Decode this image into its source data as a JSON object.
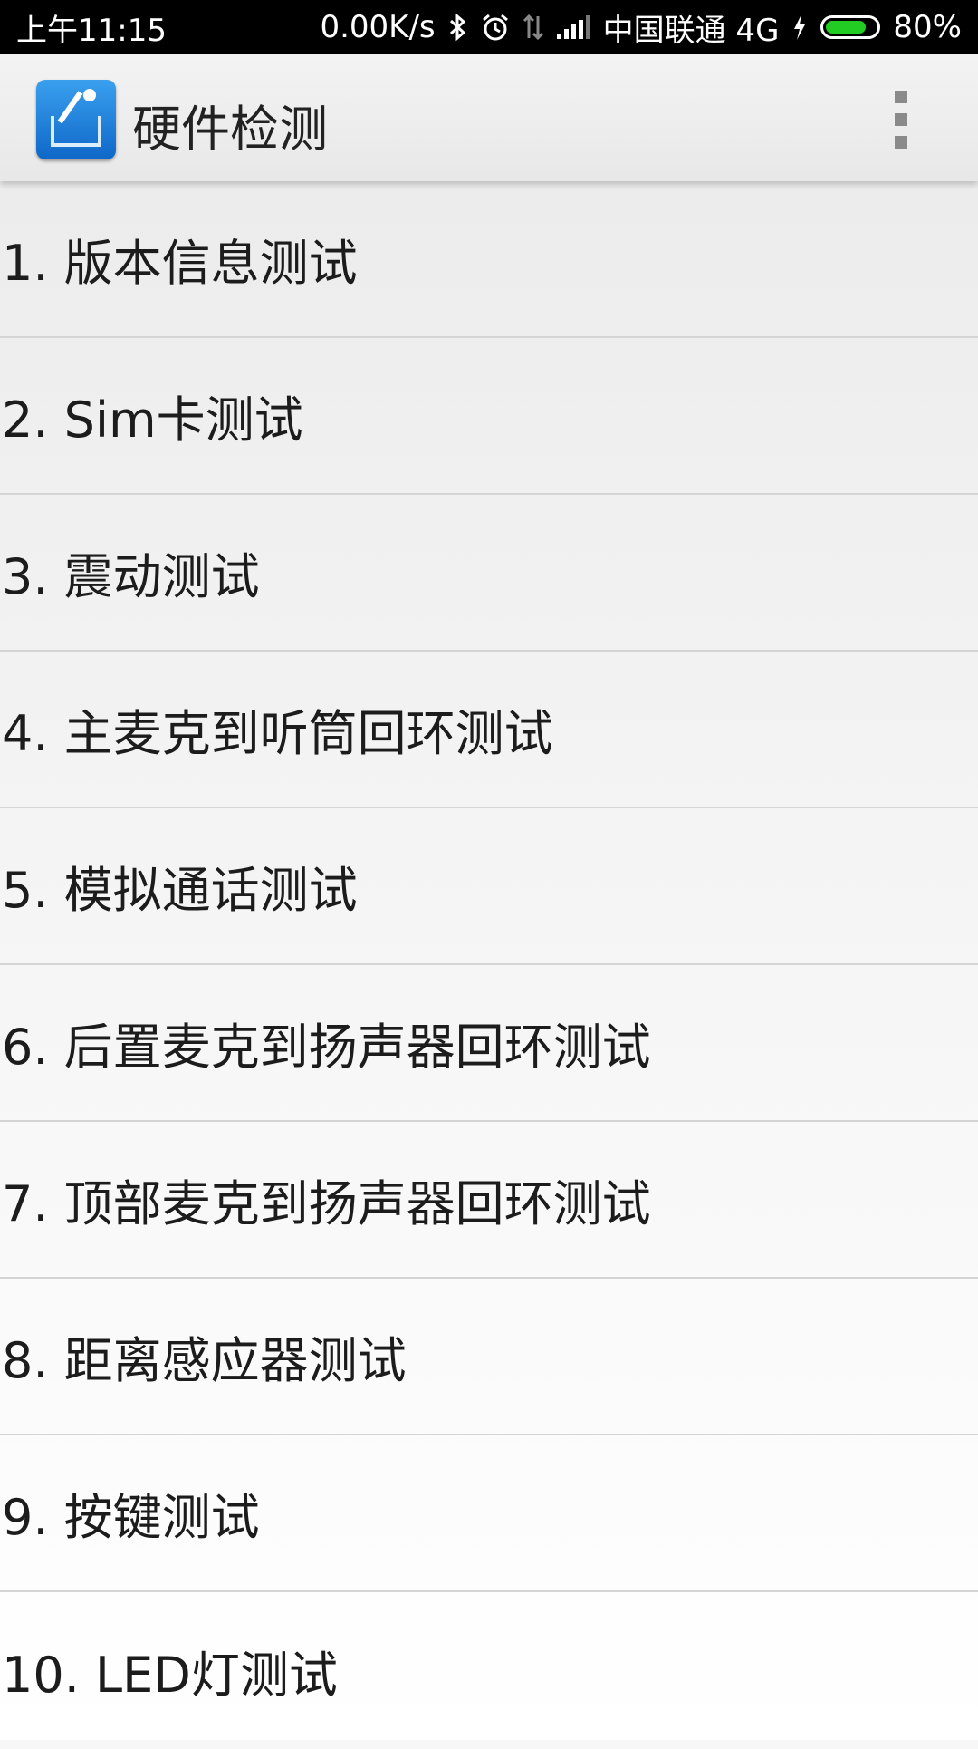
{
  "status_bar": {
    "time": "上午11:15",
    "net_speed": "0.00K/s",
    "carrier": "中国联通 4G",
    "battery_percent": "80%",
    "battery_level": 0.8,
    "battery_color": "#22cc22",
    "icons": [
      "bluetooth-icon",
      "alarm-icon",
      "data-arrows-icon",
      "signal-icon",
      "charging-icon",
      "battery-icon"
    ]
  },
  "app_bar": {
    "title": "硬件检测",
    "logo_icon": "hardware-test-logo-icon",
    "menu_icon": "overflow-menu-icon"
  },
  "test_list": [
    {
      "label": "1. 版本信息测试"
    },
    {
      "label": "2. Sim卡测试"
    },
    {
      "label": "3. 震动测试"
    },
    {
      "label": "4. 主麦克到听筒回环测试"
    },
    {
      "label": "5. 模拟通话测试"
    },
    {
      "label": "6. 后置麦克到扬声器回环测试"
    },
    {
      "label": "7. 顶部麦克到扬声器回环测试"
    },
    {
      "label": "8. 距离感应器测试"
    },
    {
      "label": "9. 按键测试"
    },
    {
      "label": "10. LED灯测试"
    }
  ]
}
